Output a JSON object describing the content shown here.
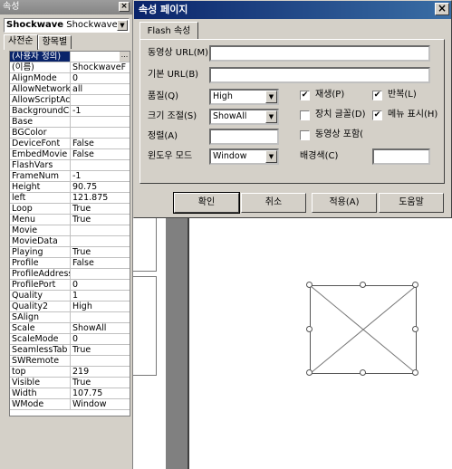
{
  "properties_panel": {
    "title": "속성",
    "close_glyph": "×",
    "object_name": "Shockwave",
    "object_type": "Shockwave",
    "tabs": [
      "사전순",
      "항목별"
    ],
    "rows": [
      {
        "name": "(사용자 정의)",
        "value": ""
      },
      {
        "name": "(이름)",
        "value": "ShockwaveF"
      },
      {
        "name": "AlignMode",
        "value": "0"
      },
      {
        "name": "AllowNetworki",
        "value": "all"
      },
      {
        "name": "AllowScriptAc",
        "value": ""
      },
      {
        "name": "BackgroundC",
        "value": "-1"
      },
      {
        "name": "Base",
        "value": ""
      },
      {
        "name": "BGColor",
        "value": ""
      },
      {
        "name": "DeviceFont",
        "value": "False"
      },
      {
        "name": "EmbedMovie",
        "value": "False"
      },
      {
        "name": "FlashVars",
        "value": ""
      },
      {
        "name": "FrameNum",
        "value": "-1"
      },
      {
        "name": "Height",
        "value": "90.75"
      },
      {
        "name": "left",
        "value": "121.875"
      },
      {
        "name": "Loop",
        "value": "True"
      },
      {
        "name": "Menu",
        "value": "True"
      },
      {
        "name": "Movie",
        "value": ""
      },
      {
        "name": "MovieData",
        "value": ""
      },
      {
        "name": "Playing",
        "value": "True"
      },
      {
        "name": "Profile",
        "value": "False"
      },
      {
        "name": "ProfileAddress",
        "value": ""
      },
      {
        "name": "ProfilePort",
        "value": "0"
      },
      {
        "name": "Quality",
        "value": "1"
      },
      {
        "name": "Quality2",
        "value": "High"
      },
      {
        "name": "SAlign",
        "value": ""
      },
      {
        "name": "Scale",
        "value": "ShowAll"
      },
      {
        "name": "ScaleMode",
        "value": "0"
      },
      {
        "name": "SeamlessTab",
        "value": "True"
      },
      {
        "name": "SWRemote",
        "value": ""
      },
      {
        "name": "top",
        "value": "219"
      },
      {
        "name": "Visible",
        "value": "True"
      },
      {
        "name": "Width",
        "value": "107.75"
      },
      {
        "name": "WMode",
        "value": "Window"
      }
    ]
  },
  "dialog": {
    "title": "속성 페이지",
    "close_glyph": "×",
    "tab": "Flash 속성",
    "movie_url_label": "동영상 URL(M)",
    "movie_url_value": "",
    "base_url_label": "기본 URL(B)",
    "base_url_value": "",
    "quality_label": "품질(Q)",
    "quality_value": "High",
    "scale_label": "크기 조절(S)",
    "scale_value": "ShowAll",
    "align_label": "정렬(A)",
    "align_value": "",
    "window_mode_label": "윈도우 모드",
    "window_mode_value": "Window",
    "play_label": "재생(P)",
    "play_checked": "✔",
    "loop_label": "반복(L)",
    "loop_checked": "✔",
    "device_font_label": "장치 글꼴(D)",
    "device_font_checked": "",
    "show_menu_label": "메뉴 표시(H)",
    "show_menu_checked": "✔",
    "embed_movie_label": "동영상 포함(",
    "embed_movie_checked": "",
    "bgcolor_label": "배경색(C)",
    "bgcolor_value": "",
    "buttons": {
      "ok": "확인",
      "cancel": "취소",
      "apply": "적용(A)",
      "help": "도움말"
    },
    "dropdown_glyph": "▼",
    "ellipsis_glyph": "..."
  }
}
